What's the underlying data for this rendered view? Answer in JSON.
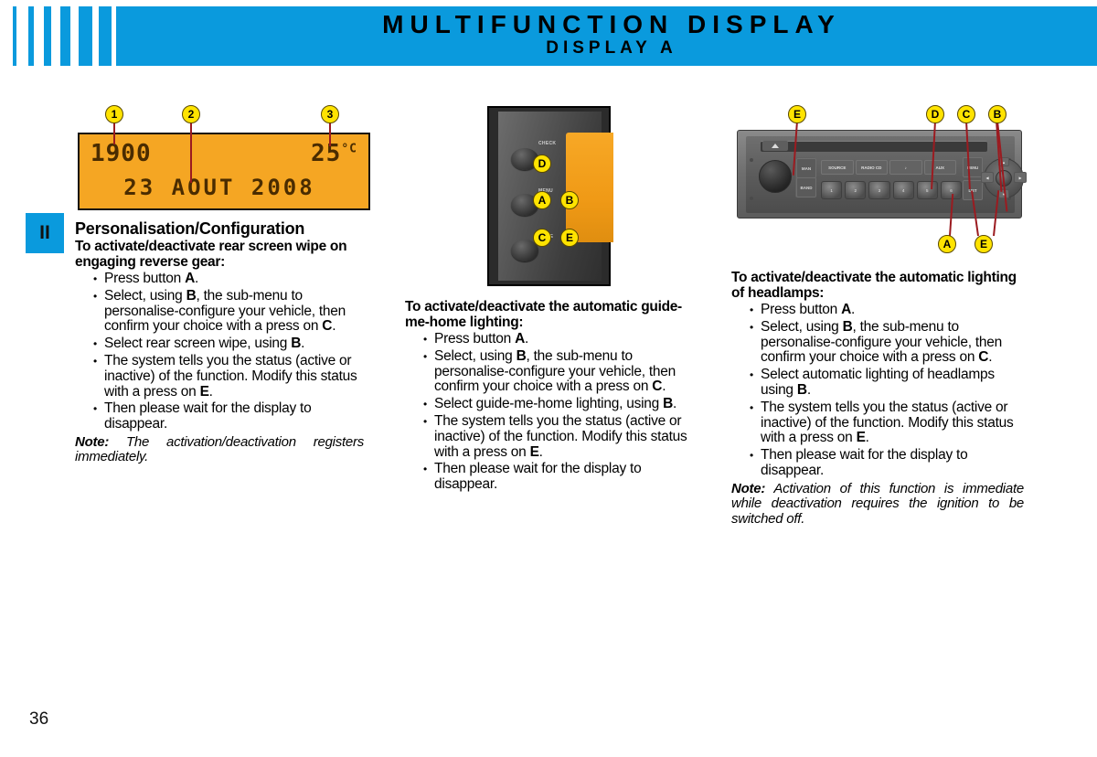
{
  "header": {
    "title": "MULTIFUNCTION DISPLAY",
    "subtitle": "DISPLAY A",
    "accent_color": "#0a9add"
  },
  "section_tab": {
    "label": "II"
  },
  "page_number": "36",
  "figures": {
    "display_unit": {
      "name": "multifunction-display-screen",
      "screen_color": "#f5a623",
      "time": "1900",
      "date": "23 AOUT 2008",
      "temperature": "25",
      "temperature_unit": "°C",
      "callouts": [
        {
          "label": "1"
        },
        {
          "label": "2"
        },
        {
          "label": "3"
        }
      ]
    },
    "centre_panel": {
      "name": "instrument-panel-buttons",
      "callouts": [
        {
          "label": "D"
        },
        {
          "label": "A"
        },
        {
          "label": "B"
        },
        {
          "label": "C"
        },
        {
          "label": "E"
        }
      ],
      "knob_labels": [
        "CHECK",
        "MENU",
        "MODE"
      ]
    },
    "car_radio": {
      "name": "car-radio-head-unit",
      "callouts": [
        {
          "label": "E"
        },
        {
          "label": "D"
        },
        {
          "label": "C"
        },
        {
          "label": "B"
        },
        {
          "label": "A"
        },
        {
          "label": "E"
        }
      ],
      "side_buttons": [
        "MAN",
        "BAND"
      ],
      "source_buttons": [
        "SOURCE",
        "RADIO CD",
        "♪",
        "AUX"
      ],
      "preset_buttons": [
        "1",
        "2",
        "3",
        "4",
        "5",
        "6"
      ],
      "menu_buttons": [
        "MENU",
        "LIST"
      ],
      "nav_buttons": [
        "◀",
        "▶",
        "▲",
        "▼"
      ]
    }
  },
  "columns": {
    "left": {
      "title": "Personalisation/Configuration",
      "sub_head": "To activate/deactivate rear screen wipe on engaging reverse gear:",
      "steps": [
        "Press button A.",
        "Select, using B, the sub-menu to personalise-configure your vehicle, then confirm your choice with a press on C.",
        "Select rear screen wipe, using B.",
        "The system tells you the status (active or inactive) of the function. Modify this status with a press on E.",
        "Then please wait for the display to disappear."
      ],
      "note_label": "Note:",
      "note_text": "The activation/deactivation registers immediately."
    },
    "middle": {
      "sub_head": "To activate/deactivate the automatic guide-me-home lighting:",
      "steps": [
        "Press button A.",
        "Select, using B, the sub-menu to personalise-configure your vehicle, then confirm your choice with a press on C.",
        "Select guide-me-home lighting, using B.",
        "The system tells you the status (active or inactive) of the function. Modify this status with a press on E.",
        "Then please wait for the display to disappear."
      ]
    },
    "right": {
      "sub_head": "To activate/deactivate the automatic lighting of headlamps:",
      "steps": [
        "Press button A.",
        "Select, using B, the sub-menu to personalise-configure your vehicle, then confirm your choice with a press on C.",
        "Select automatic lighting of headlamps using B.",
        "The system tells you the status (active or inactive) of the function. Modify this status with a press on E.",
        "Then please wait for the display to disappear."
      ],
      "note_label": "Note:",
      "note_text": "Activation of this function is immediate while deactivation requires the ignition to be switched off."
    }
  }
}
